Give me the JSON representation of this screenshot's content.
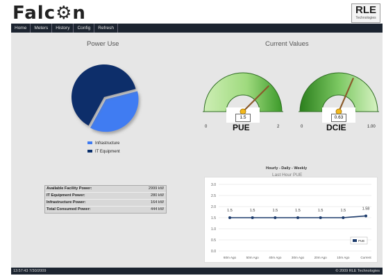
{
  "header": {
    "brand": "Falc⚙n",
    "logo_main": "RLE",
    "logo_sub": "Technologies"
  },
  "nav": {
    "tabs": [
      "Home",
      "Meters",
      "History",
      "Config",
      "Refresh"
    ]
  },
  "power_use": {
    "title": "Power Use",
    "legend": [
      {
        "label": "Infrastructure",
        "color": "#3f7bf2"
      },
      {
        "label": "IT Equipment",
        "color": "#0a2f6b"
      }
    ],
    "slices": [
      {
        "name": "Infrastructure",
        "value": 164,
        "color": "#3f7bf2"
      },
      {
        "name": "IT Equipment",
        "value": 280,
        "color": "#0a2f6b"
      }
    ],
    "stats": [
      {
        "label": "Available Facility Power:",
        "value": "2999 kW"
      },
      {
        "label": "IT Equipment Power:",
        "value": "280 kW"
      },
      {
        "label": "Infrastructure Power:",
        "value": "164 kW"
      },
      {
        "label": "Total Consumed Power:",
        "value": "444 kW"
      }
    ]
  },
  "current_values": {
    "title": "Current Values",
    "gauges": [
      {
        "name": "PUE",
        "reading": "1.5",
        "min_label": "0",
        "max_label": "2",
        "fraction": 0.75
      },
      {
        "name": "DCIE",
        "reading": "0.63",
        "min_label": "0",
        "max_label": "1.00",
        "fraction": 0.63
      }
    ]
  },
  "chart_data": {
    "type": "line",
    "title": "Hourly - Daily - Weekly",
    "subtitle": "Last Hour PUE",
    "categories": [
      "60m Ago",
      "50m Ago",
      "40m Ago",
      "30m Ago",
      "20m Ago",
      "10m Ago",
      "Current"
    ],
    "series": [
      {
        "name": "PUE",
        "values": [
          1.5,
          1.5,
          1.5,
          1.5,
          1.5,
          1.5,
          1.58
        ]
      }
    ],
    "data_labels": [
      "1.5",
      "1.5",
      "1.5",
      "1.5",
      "1.5",
      "1.5",
      "1.58"
    ],
    "y_ticks": [
      "3.0",
      "2.5",
      "2.0",
      "1.5",
      "1.0",
      "0.5",
      "0.0"
    ],
    "ylim": [
      0,
      3
    ],
    "grid": true,
    "legend_position": "bottom-right",
    "line_color": "#1b3a6b"
  },
  "footer": {
    "left": "13:57:43 7/30/2009",
    "right": "© 2009 RLE Technologies"
  }
}
